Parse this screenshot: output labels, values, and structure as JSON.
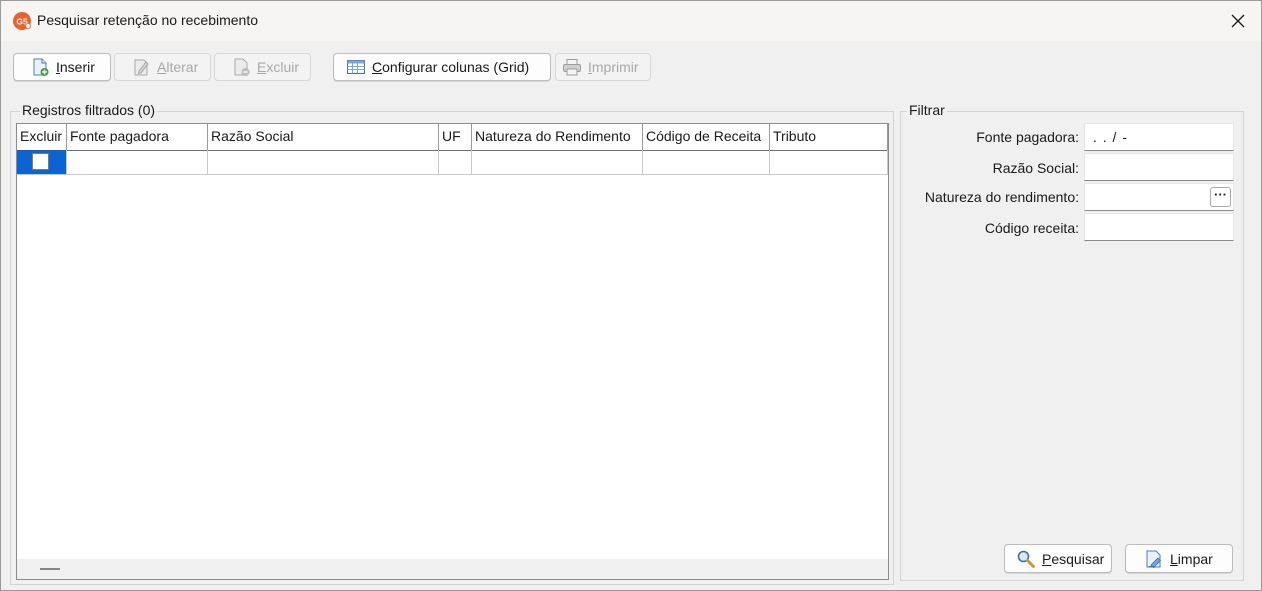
{
  "window": {
    "title": "Pesquisar retenção no recebimento",
    "app_icon_text": "G5"
  },
  "toolbar": {
    "inserir": {
      "pre": "",
      "key": "I",
      "rest": "nserir"
    },
    "alterar": {
      "pre": "",
      "key": "A",
      "rest": "lterar"
    },
    "excluir": {
      "pre": "",
      "key": "E",
      "rest": "xcluir"
    },
    "configurar": {
      "pre": "",
      "key": "C",
      "rest": "onfigurar colunas (Grid)"
    },
    "imprimir": {
      "pre": "",
      "key": "I",
      "rest": "mprimir"
    }
  },
  "registros": {
    "label": "Registros filtrados (0)",
    "columns": [
      "Excluir",
      "Fonte pagadora",
      "Razão Social",
      "UF",
      "Natureza do Rendimento",
      "Código de Receita",
      "Tributo"
    ]
  },
  "filtrar": {
    "label": "Filtrar",
    "fonte_label": "Fonte pagadora:",
    "fonte_value": ". . /  -",
    "razao_label": "Razão Social:",
    "razao_value": "",
    "natureza_label": "Natureza do rendimento:",
    "natureza_value": "",
    "natureza_button": "···",
    "codigo_label": "Código receita:",
    "codigo_value": ""
  },
  "actions": {
    "pesquisar": {
      "key": "P",
      "rest": "esquisar"
    },
    "limpar": {
      "key": "L",
      "rest": "impar"
    }
  },
  "colors": {
    "selection": "#0a64d2",
    "app_icon": "#e8622a"
  }
}
